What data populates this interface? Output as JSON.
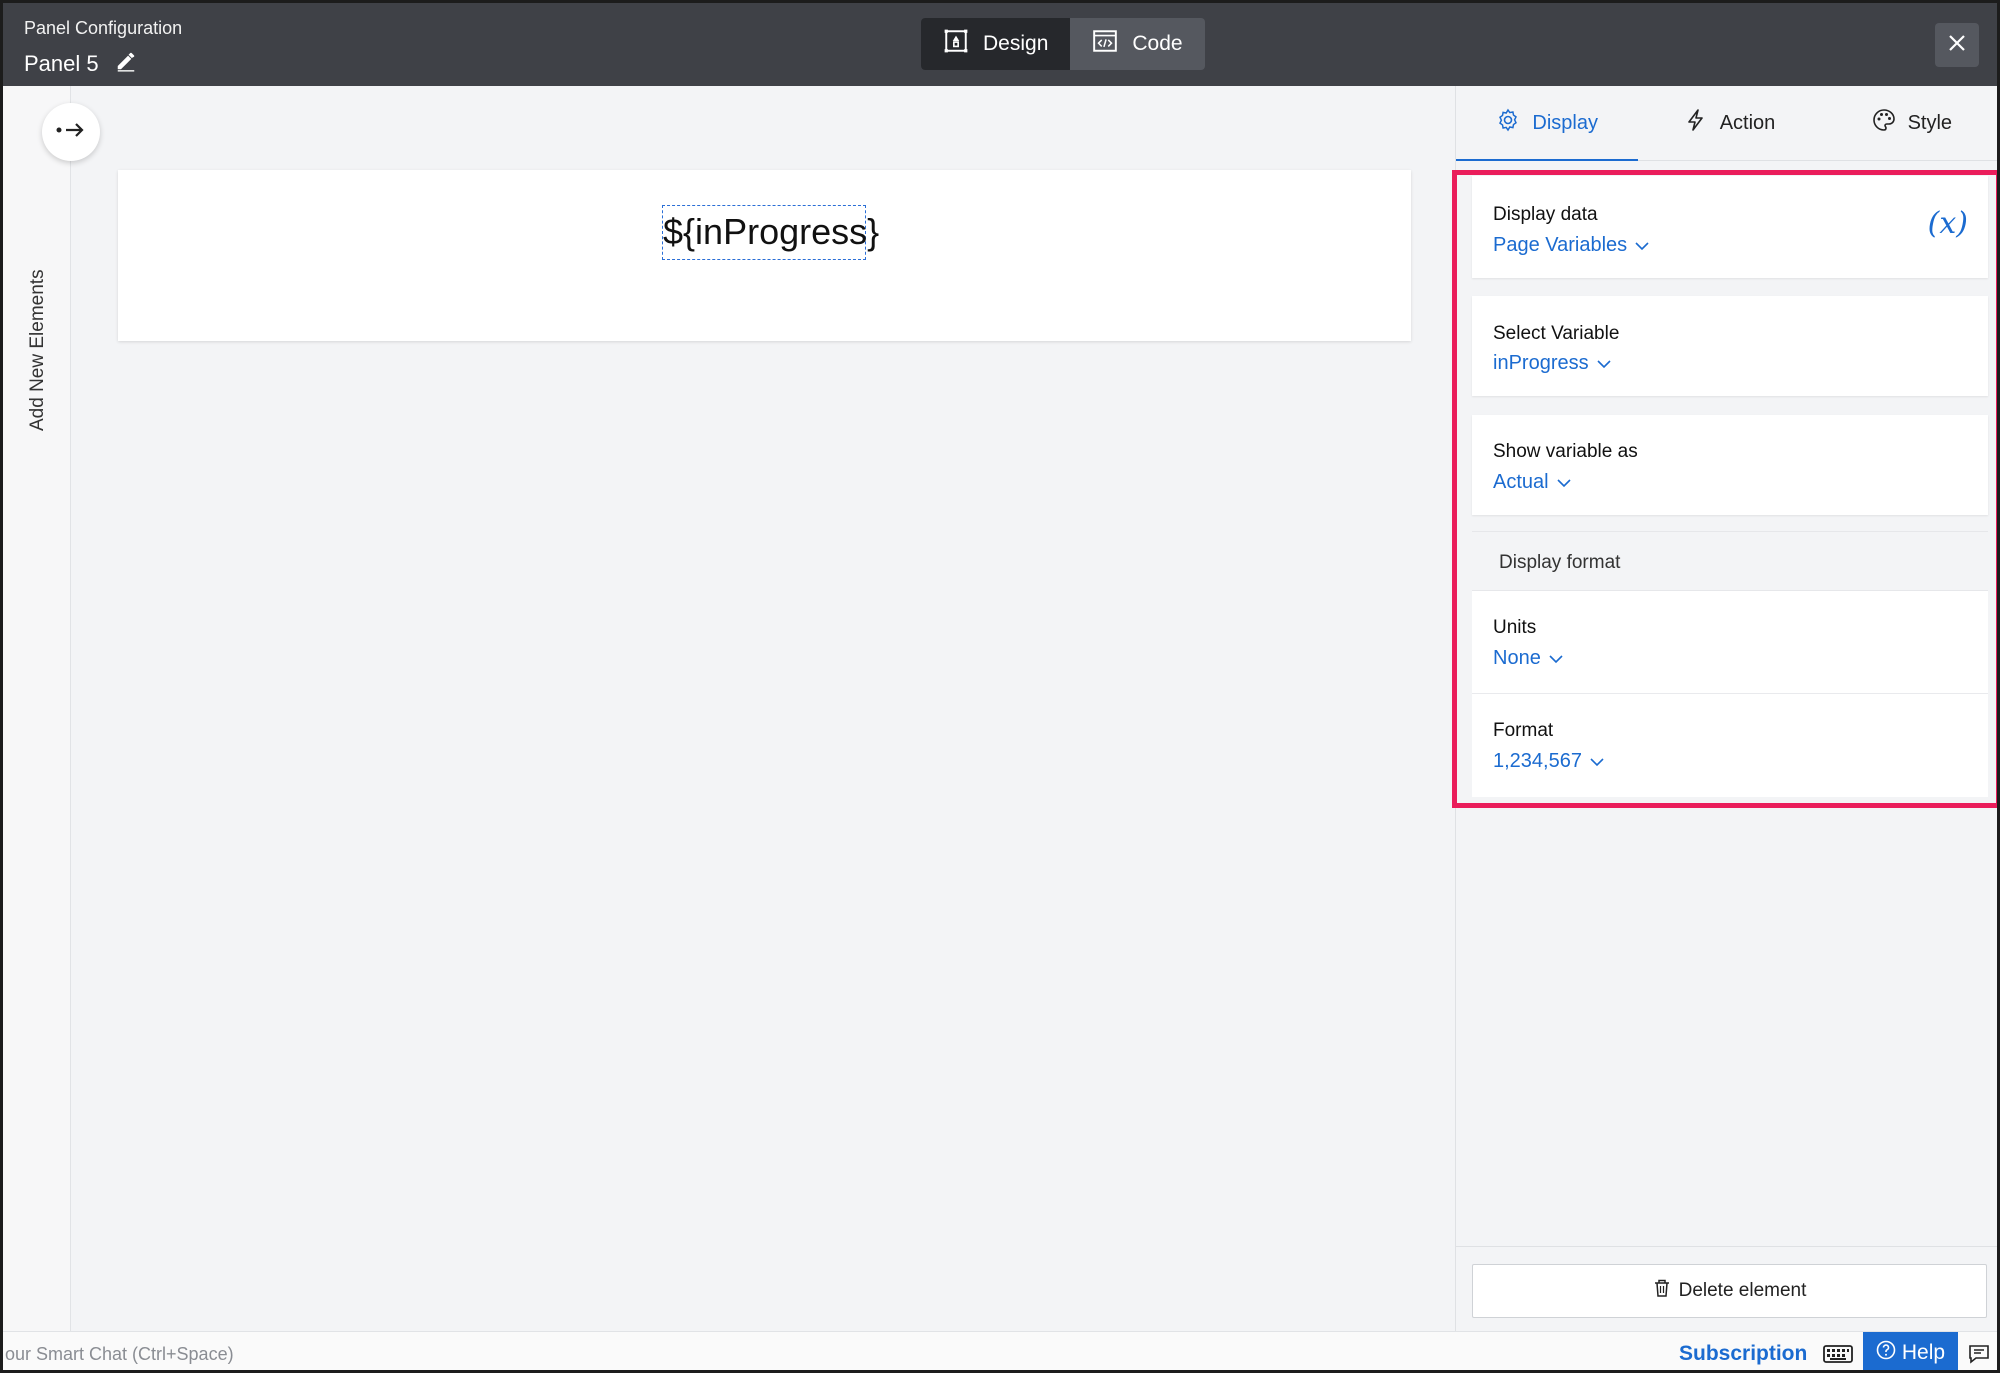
{
  "header": {
    "subtitle": "Panel Configuration",
    "panel_name": "Panel 5",
    "modes": [
      {
        "label": "Design",
        "icon": "design-icon",
        "active": true
      },
      {
        "label": "Code",
        "icon": "code-icon",
        "active": false
      }
    ]
  },
  "left_strip": {
    "vertical_label": "Add New Elements"
  },
  "canvas": {
    "placeholder_text": "${inProgress}"
  },
  "right_panel": {
    "tabs": [
      {
        "label": "Display",
        "icon": "gear-icon",
        "active": true
      },
      {
        "label": "Action",
        "icon": "lightning-icon",
        "active": false
      },
      {
        "label": "Style",
        "icon": "palette-icon",
        "active": false
      }
    ],
    "display_data": {
      "label": "Display data",
      "value": "Page Variables"
    },
    "select_variable": {
      "label": "Select Variable",
      "value": "inProgress"
    },
    "show_variable_as": {
      "label": "Show variable as",
      "value": "Actual"
    },
    "display_format": {
      "label": "Display format"
    },
    "units": {
      "label": "Units",
      "value": "None"
    },
    "format": {
      "label": "Format",
      "value": "1,234,567"
    },
    "delete_label": "Delete element",
    "highlight_color": "#ea1d5b"
  },
  "statusbar": {
    "chat_hint": "our Smart Chat (Ctrl+Space)",
    "subscription": "Subscription",
    "help": "Help"
  },
  "colors": {
    "accent": "#1b6bd0",
    "header_bg": "#3f4147"
  }
}
